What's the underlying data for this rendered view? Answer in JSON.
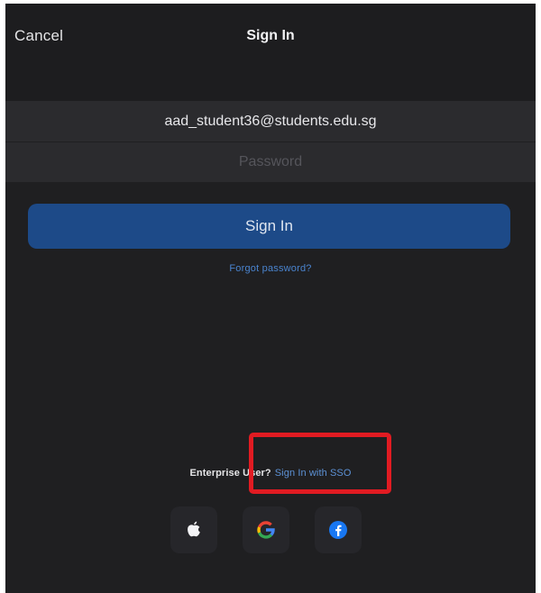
{
  "header": {
    "cancel_label": "Cancel",
    "title": "Sign In"
  },
  "form": {
    "email_value": "aad_student36@students.edu.sg",
    "password_placeholder": "Password",
    "signin_label": "Sign In",
    "forgot_label": "Forgot password?"
  },
  "enterprise": {
    "question": "Enterprise User?",
    "sso_label": "Sign In with SSO"
  },
  "social": [
    {
      "name": "apple-icon"
    },
    {
      "name": "google-icon"
    },
    {
      "name": "facebook-icon"
    }
  ],
  "colors": {
    "background": "#1f1f21",
    "field_background": "#2b2b2e",
    "primary_button": "#1d4a88",
    "link": "#4a84cf",
    "highlight": "#e11b22"
  }
}
